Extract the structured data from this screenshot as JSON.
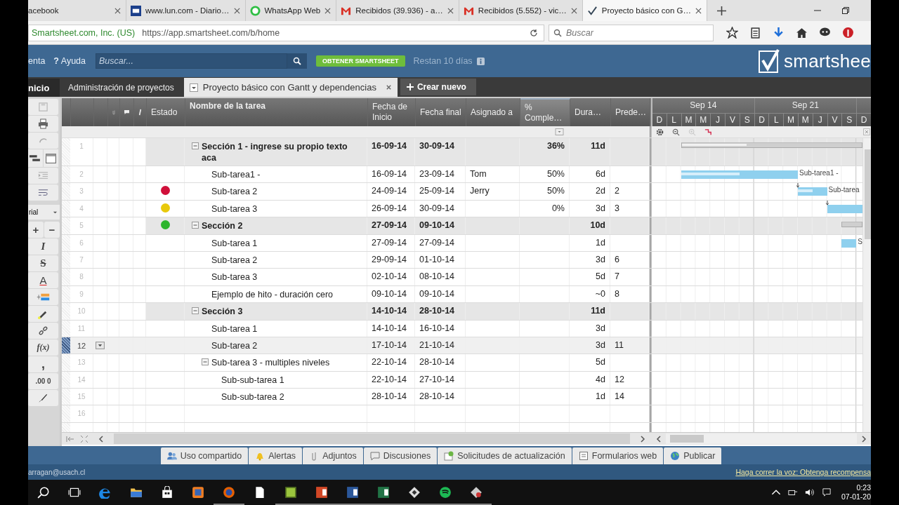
{
  "browser": {
    "tabs": [
      {
        "title": "acebook",
        "kind": "plain",
        "selected": false
      },
      {
        "title": "www.lun.com - Diario…",
        "kind": "lun",
        "selected": false
      },
      {
        "title": "WhatsApp Web",
        "kind": "whatsapp",
        "selected": false
      },
      {
        "title": "Recibidos (39.936) - a…",
        "kind": "mail",
        "selected": false
      },
      {
        "title": "Recibidos (5.552) - vic…",
        "kind": "mail",
        "selected": false
      },
      {
        "title": "Proyecto básico con G…",
        "kind": "check",
        "selected": true
      }
    ],
    "identity": "Smartsheet.com, Inc. (US)",
    "url": "https://app.smartsheet.com/b/home",
    "search_placeholder": "Buscar"
  },
  "app": {
    "account": "enta",
    "help_glyph": "?",
    "help": "Ayuda",
    "search_placeholder": "Buscar...",
    "upgrade": "OBTENER SMARTSHEET",
    "trial": "Restan 10 días",
    "logo": "smartshee"
  },
  "nav": {
    "tabs": [
      {
        "label": "nicio",
        "kind": "home",
        "selected": false
      },
      {
        "label": "Administración de proyectos",
        "kind": "sheet",
        "selected": false
      },
      {
        "label": "Proyecto básico con Gantt y dependencias",
        "kind": "sheet",
        "selected": true
      }
    ],
    "new_button": "Crear nuevo"
  },
  "toolbar": {
    "font": "rial",
    "increase": "+",
    "decrease": "−",
    "italic": "I",
    "strike": "S",
    "font_glyph": "A",
    "formula": "f(x)",
    "comma": ",",
    "decimal": ".00",
    "decimal_to": "0"
  },
  "columns": {
    "status": "Estado",
    "name": "Nombre de la tarea",
    "start": "Fecha de Inicio",
    "end": "Fecha final",
    "assigned": "Asignado a",
    "complete": "% Comple…",
    "duration": "Dura…",
    "pred": "Prede…"
  },
  "gantt": {
    "weeks": [
      "Sep 14",
      "Sep 21"
    ],
    "days": [
      "D",
      "L",
      "M",
      "M",
      "J",
      "V",
      "S",
      "D",
      "L",
      "M",
      "M",
      "J",
      "V",
      "S",
      "D"
    ]
  },
  "rows": [
    {
      "num": "1",
      "name": "Sección 1 - ingrese su propio texto aca",
      "start": "16-09-14",
      "end": "30-09-14",
      "complete": "36%",
      "duration": "11d",
      "selected": false,
      "expanded": true,
      "children": [
        {
          "num": "2",
          "name": "Sub-tarea1 -",
          "start": "16-09-14",
          "end": "23-09-14",
          "assigned": "Tom",
          "complete": "50%",
          "duration": "6d",
          "gantt_label": "Sub-tarea1 -",
          "selected": false
        },
        {
          "num": "3",
          "color": "#d0103a",
          "name": "Sub-tarea 2",
          "start": "24-09-14",
          "end": "25-09-14",
          "assigned": "Jerry",
          "complete": "50%",
          "duration": "2d",
          "pred": "2",
          "gantt_label": "Sub-tarea",
          "selected": false
        },
        {
          "num": "4",
          "color": "#e8c90c",
          "name": "Sub-tarea 3",
          "start": "26-09-14",
          "end": "30-09-14",
          "complete": "0%",
          "duration": "3d",
          "pred": "3",
          "selected": false
        }
      ]
    },
    {
      "num": "5",
      "color": "#2db52d",
      "name": "Sección 2",
      "start": "27-09-14",
      "end": "09-10-14",
      "duration": "10d",
      "selected": false,
      "expanded": true,
      "children": [
        {
          "num": "6",
          "name": "Sub-tarea 1",
          "start": "27-09-14",
          "end": "27-09-14",
          "duration": "1d",
          "gantt_label": "S",
          "selected": false
        },
        {
          "num": "7",
          "name": "Sub-tarea 2",
          "start": "29-09-14",
          "end": "01-10-14",
          "duration": "3d",
          "pred": "6",
          "selected": false
        },
        {
          "num": "8",
          "name": "Sub-tarea 3",
          "start": "02-10-14",
          "end": "08-10-14",
          "duration": "5d",
          "pred": "7",
          "selected": false
        },
        {
          "num": "9",
          "name": "Ejemplo de hito - duración cero",
          "start": "09-10-14",
          "end": "09-10-14",
          "duration": "~0",
          "pred": "8",
          "selected": false
        }
      ]
    },
    {
      "num": "10",
      "name": "Sección 3",
      "start": "14-10-14",
      "end": "28-10-14",
      "duration": "11d",
      "selected": false,
      "expanded": true,
      "children": [
        {
          "num": "11",
          "name": "Sub-tarea 1",
          "start": "14-10-14",
          "end": "16-10-14",
          "duration": "3d",
          "selected": false
        },
        {
          "num": "12",
          "name": "Sub-tarea 2",
          "start": "17-10-14",
          "end": "21-10-14",
          "duration": "3d",
          "pred": "11",
          "selected": true
        },
        {
          "num": "13",
          "name": "Sub-tarea 3 - multiples niveles",
          "start": "22-10-14",
          "end": "28-10-14",
          "duration": "5d",
          "selected": false,
          "expanded": true,
          "children": [
            {
              "num": "14",
              "name": "Sub-sub-tarea 1",
              "start": "22-10-14",
              "end": "27-10-14",
              "duration": "4d",
              "pred": "12",
              "selected": false
            },
            {
              "num": "15",
              "name": "Sub-sub-tarea 2",
              "start": "28-10-14",
              "end": "28-10-14",
              "duration": "1d",
              "pred": "14",
              "selected": false
            }
          ]
        }
      ]
    },
    {
      "num": "16",
      "selected": false
    }
  ],
  "bottom_tabs": [
    {
      "label": "Uso compartido",
      "kind": "people"
    },
    {
      "label": "Alertas",
      "kind": "bell"
    },
    {
      "label": "Adjuntos",
      "kind": "clip"
    },
    {
      "label": "Discusiones",
      "kind": "chat"
    },
    {
      "label": "Solicitudes de actualización",
      "kind": "update"
    },
    {
      "label": "Formularios web",
      "kind": "form"
    },
    {
      "label": "Publicar",
      "kind": "globe"
    }
  ],
  "status": {
    "email": "arragan@usach.cl",
    "promo": "Haga correr la voz: Obtenga recompensa"
  },
  "taskbar": {
    "time": "0:23",
    "date": "07-01-20"
  }
}
